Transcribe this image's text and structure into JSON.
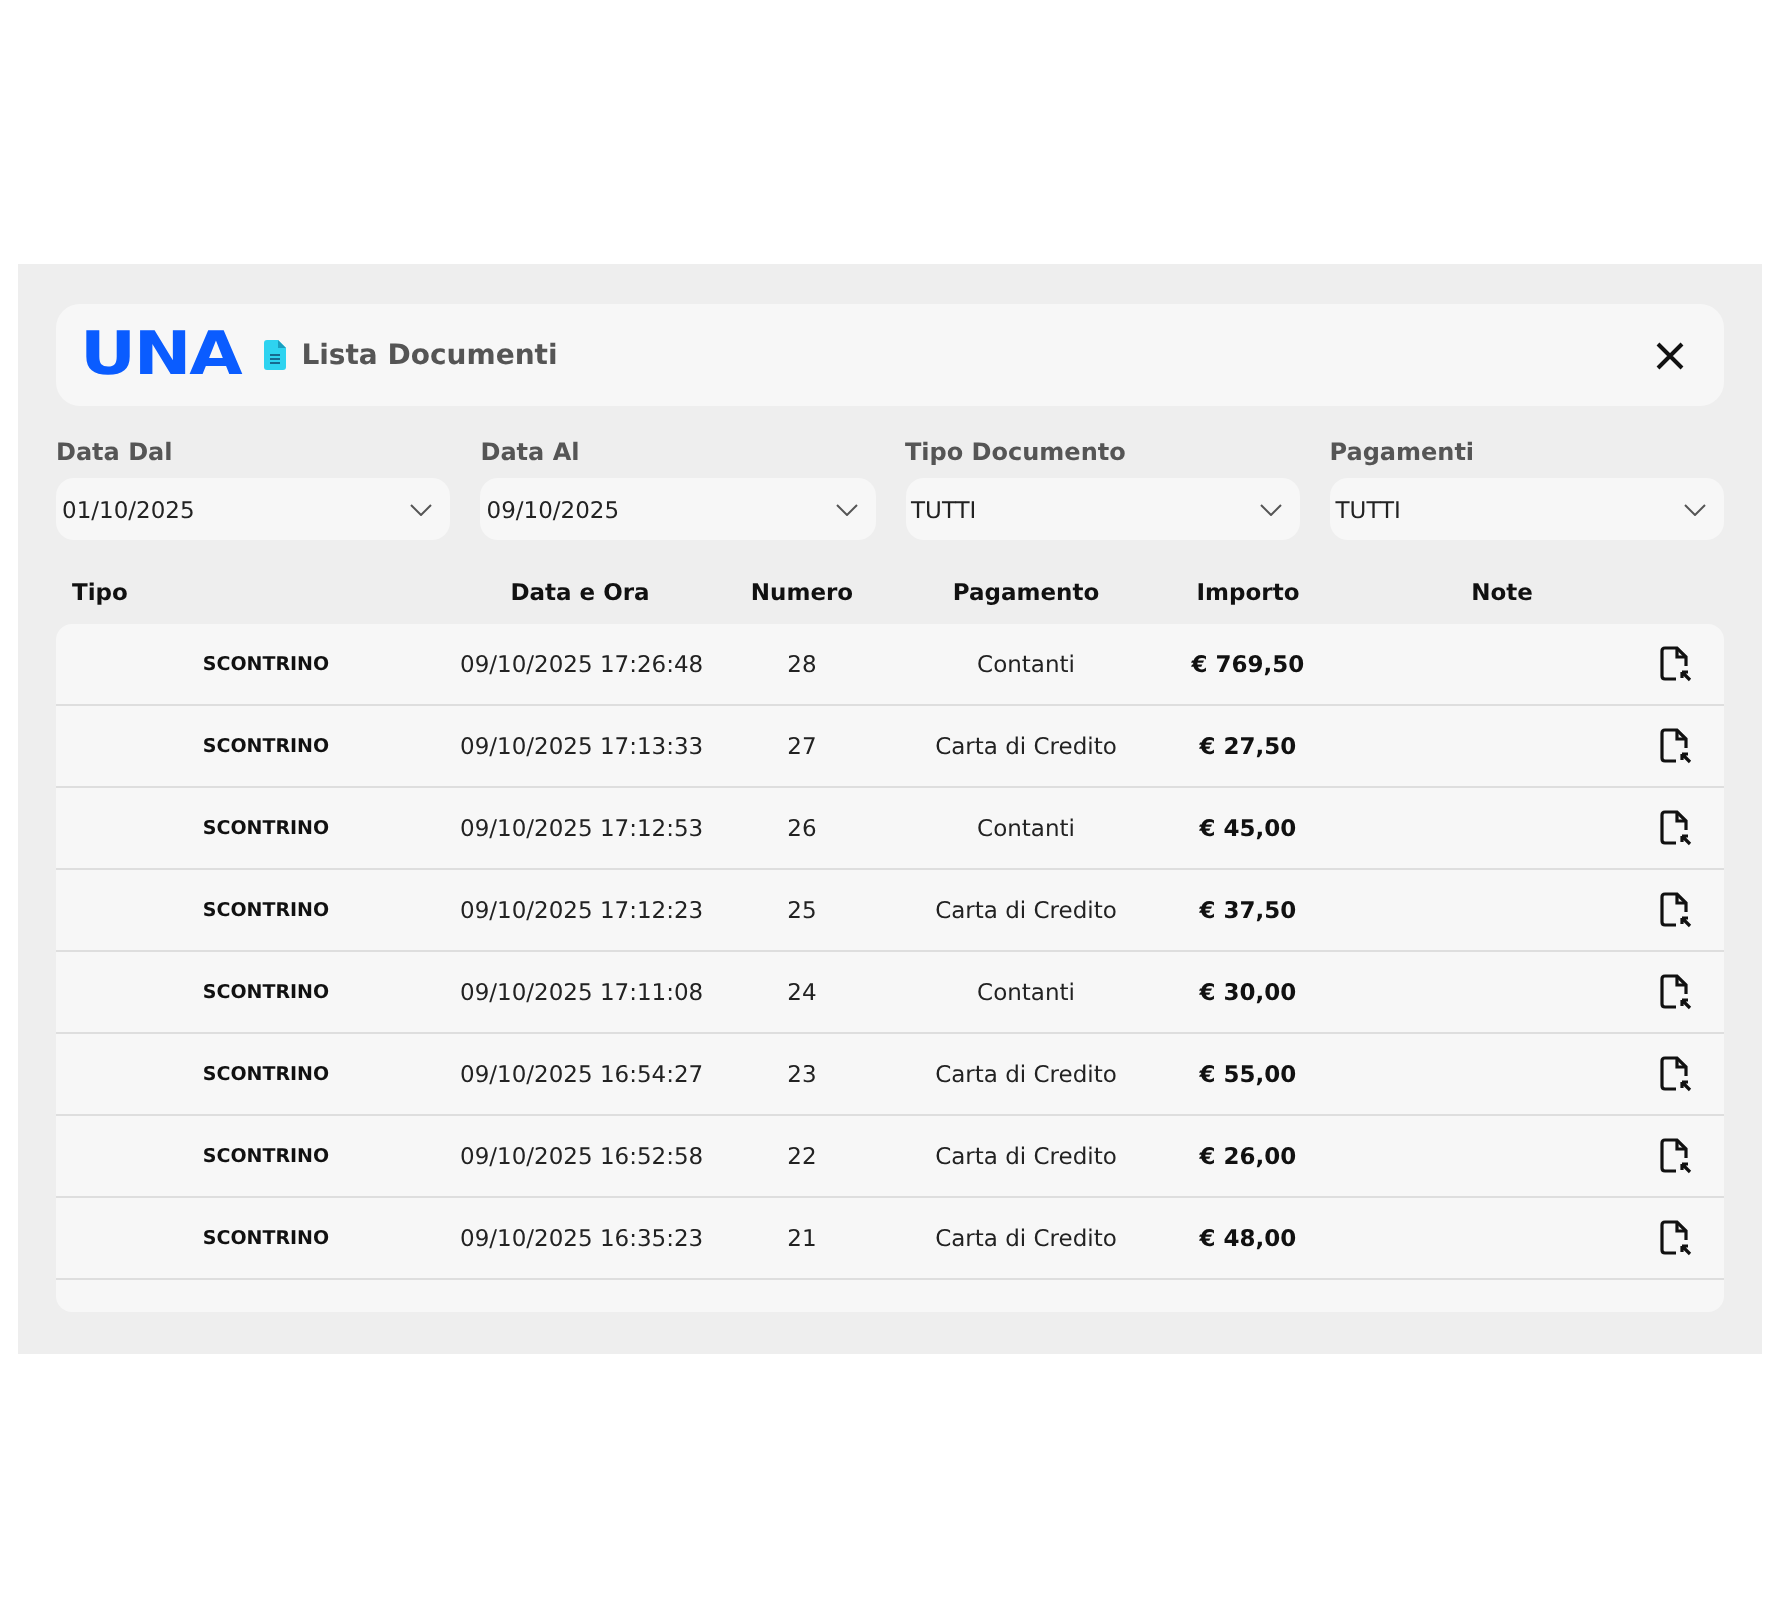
{
  "header": {
    "logo": "UNA",
    "title": "Lista Documenti"
  },
  "filters": [
    {
      "label": "Data Dal",
      "value": "01/10/2025"
    },
    {
      "label": "Data Al",
      "value": "09/10/2025"
    },
    {
      "label": "Tipo Documento",
      "value": "TUTTI"
    },
    {
      "label": "Pagamenti",
      "value": "TUTTI"
    }
  ],
  "table": {
    "columns": [
      "Tipo",
      "Data e Ora",
      "Numero",
      "Pagamento",
      "Importo",
      "Note"
    ],
    "rows": [
      {
        "tipo": "SCONTRINO",
        "data": "09/10/2025 17:26:48",
        "numero": "28",
        "pagamento": "Contanti",
        "importo": "€ 769,50"
      },
      {
        "tipo": "SCONTRINO",
        "data": "09/10/2025 17:13:33",
        "numero": "27",
        "pagamento": "Carta di Credito",
        "importo": "€ 27,50"
      },
      {
        "tipo": "SCONTRINO",
        "data": "09/10/2025 17:12:53",
        "numero": "26",
        "pagamento": "Contanti",
        "importo": "€ 45,00"
      },
      {
        "tipo": "SCONTRINO",
        "data": "09/10/2025 17:12:23",
        "numero": "25",
        "pagamento": "Carta di Credito",
        "importo": "€ 37,50"
      },
      {
        "tipo": "SCONTRINO",
        "data": "09/10/2025 17:11:08",
        "numero": "24",
        "pagamento": "Contanti",
        "importo": "€ 30,00"
      },
      {
        "tipo": "SCONTRINO",
        "data": "09/10/2025 16:54:27",
        "numero": "23",
        "pagamento": "Carta di Credito",
        "importo": "€ 55,00"
      },
      {
        "tipo": "SCONTRINO",
        "data": "09/10/2025 16:52:58",
        "numero": "22",
        "pagamento": "Carta di Credito",
        "importo": "€ 26,00"
      },
      {
        "tipo": "SCONTRINO",
        "data": "09/10/2025 16:35:23",
        "numero": "21",
        "pagamento": "Carta di Credito",
        "importo": "€ 48,00"
      }
    ]
  }
}
